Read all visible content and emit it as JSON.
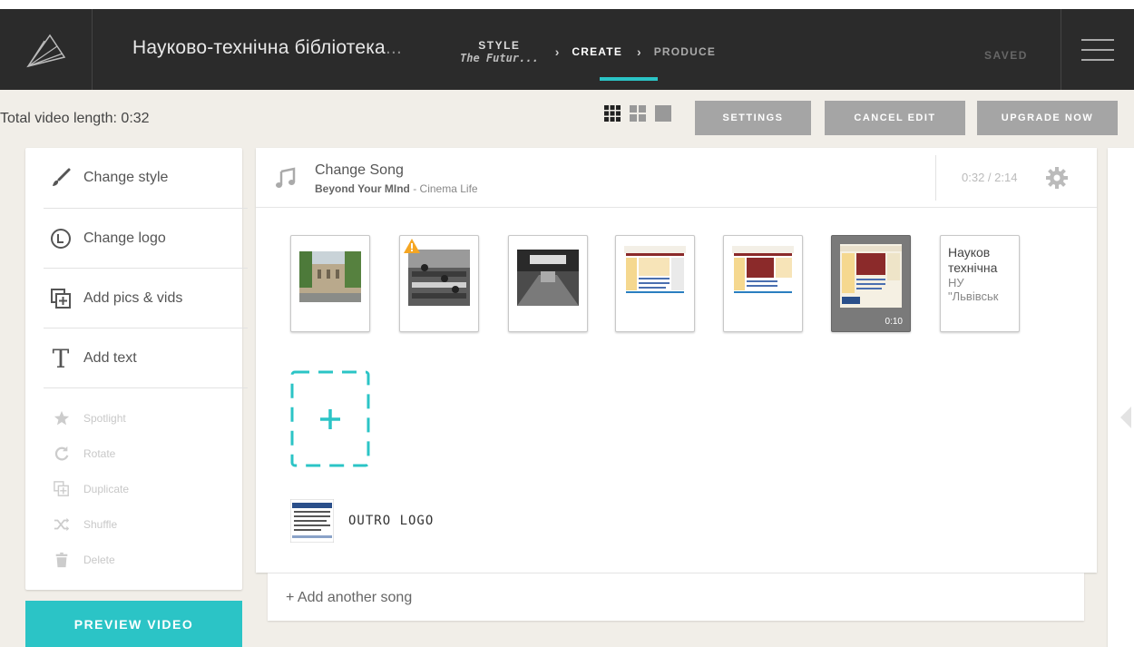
{
  "header": {
    "title_main": "Науково-технічна бібліотека",
    "title_fade": "...",
    "steps": {
      "style_label": "STYLE",
      "style_value": "The Futur...",
      "create": "CREATE",
      "produce": "PRODUCE"
    },
    "saved": "SAVED"
  },
  "toolbar": {
    "total_length": "Total video length: 0:32",
    "settings": "SETTINGS",
    "cancel_edit": "CANCEL EDIT",
    "upgrade_now": "UPGRADE NOW"
  },
  "sidebar": {
    "items": [
      {
        "label": "Change style",
        "icon": "brush-icon"
      },
      {
        "label": "Change logo",
        "icon": "logo-icon"
      },
      {
        "label": "Add pics & vids",
        "icon": "add-media-icon"
      },
      {
        "label": "Add text",
        "icon": "text-icon"
      }
    ],
    "tools": [
      {
        "label": "Spotlight",
        "icon": "star-icon"
      },
      {
        "label": "Rotate",
        "icon": "rotate-icon"
      },
      {
        "label": "Duplicate",
        "icon": "duplicate-icon"
      },
      {
        "label": "Shuffle",
        "icon": "shuffle-icon"
      },
      {
        "label": "Delete",
        "icon": "trash-icon"
      }
    ],
    "preview": "PREVIEW VIDEO"
  },
  "song": {
    "title": "Change Song",
    "track": "Beyond Your MInd",
    "artist_sep": " - Cinema Life",
    "time": "0:32 / 2:14"
  },
  "slides": {
    "selected_duration": "0:10",
    "text_slide": {
      "line1": "Науков",
      "line2": "технічна",
      "line3": "НУ",
      "line4": "\"Львівськ"
    }
  },
  "outro": {
    "label": "OUTRO LOGO"
  },
  "add_song": "+ Add another song",
  "colors": {
    "accent": "#2bc4c6",
    "topbar": "#2b2b2b",
    "button_gray": "#a5a5a5",
    "warning": "#f5a623"
  }
}
